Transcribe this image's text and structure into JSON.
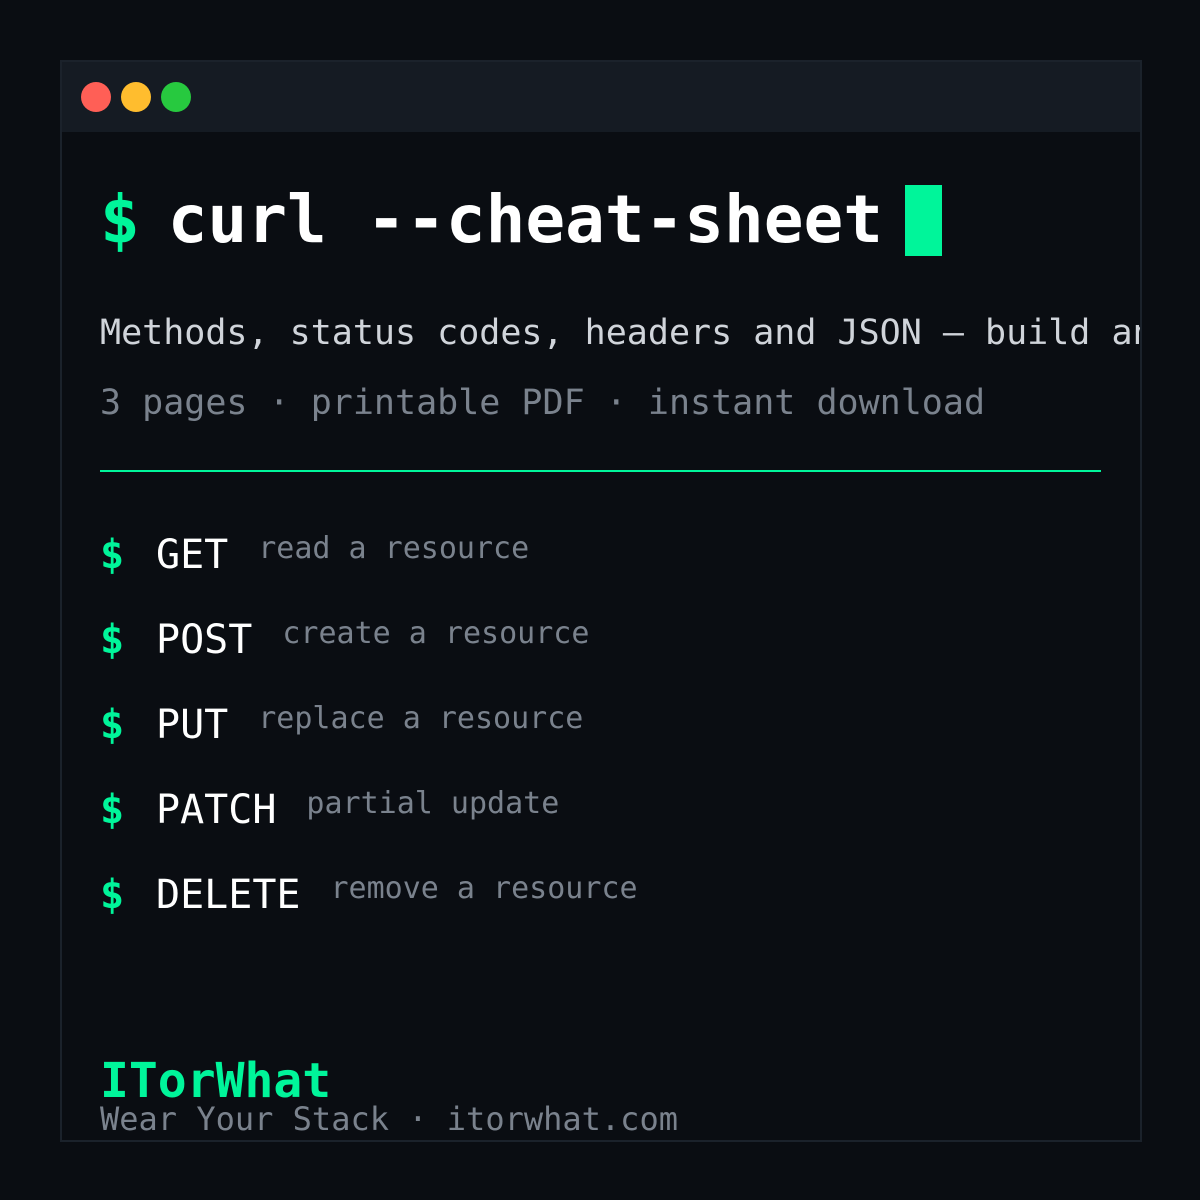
{
  "window": {
    "controls": [
      "close",
      "minimize",
      "maximize"
    ]
  },
  "title": {
    "prompt": "$",
    "command": "curl --cheat-sheet"
  },
  "subtitle": "Methods, status codes, headers and JSON — build an",
  "meta": "3 pages · printable PDF · instant download",
  "methods": [
    {
      "prompt": "$",
      "name": "GET",
      "desc": "read a resource"
    },
    {
      "prompt": "$",
      "name": "POST",
      "desc": "create a resource"
    },
    {
      "prompt": "$",
      "name": "PUT",
      "desc": "replace a resource"
    },
    {
      "prompt": "$",
      "name": "PATCH",
      "desc": "partial update"
    },
    {
      "prompt": "$",
      "name": "DELETE",
      "desc": "remove a resource"
    }
  ],
  "brand": {
    "name": "ITorWhat",
    "tagline": "Wear Your Stack · itorwhat.com"
  },
  "colors": {
    "accent": "#00f59a",
    "background": "#0a0d12",
    "titlebar": "#151b23",
    "close": "#ff5f56",
    "minimize": "#ffbd2e",
    "maximize": "#27c93f"
  }
}
